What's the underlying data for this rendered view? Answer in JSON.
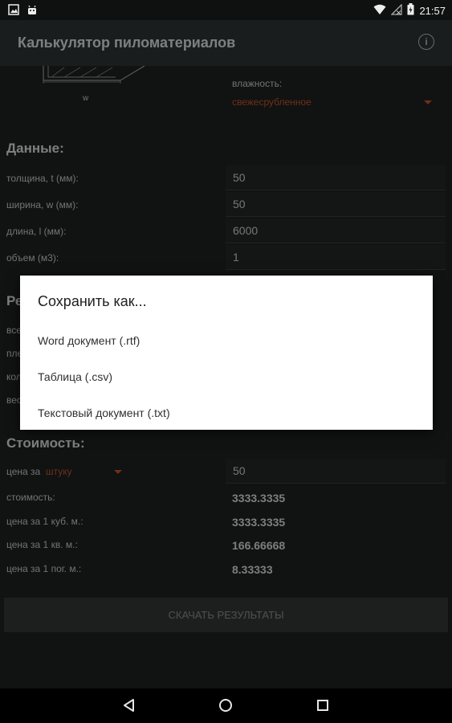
{
  "status_bar": {
    "time": "21:57"
  },
  "app": {
    "title": "Калькулятор пиломатериалов"
  },
  "diagram": {
    "w_label": "w"
  },
  "humidity": {
    "label": "влажность:",
    "value": "свежесрубленное"
  },
  "data_section": {
    "title": "Данные:",
    "rows": [
      {
        "label": "толщина, t (мм):",
        "value": "50"
      },
      {
        "label": "ширина, w (мм):",
        "value": "50"
      },
      {
        "label": "длина, l (мм):",
        "value": "6000"
      },
      {
        "label": "объем (м3):",
        "value": "1"
      }
    ]
  },
  "results_section": {
    "title_partial": "Ре",
    "row_fragments": [
      "все",
      "пле",
      "кол",
      "вес"
    ]
  },
  "cost_section": {
    "title": "Стоимость:",
    "price_label": "цена за",
    "price_unit": "штуку",
    "price_value": "50",
    "rows": [
      {
        "label": "стоимость:",
        "value": "3333.3335"
      },
      {
        "label": "цена за 1 куб. м.:",
        "value": "3333.3335"
      },
      {
        "label": "цена за 1 кв. м.:",
        "value": "166.66668"
      },
      {
        "label": "цена за 1 пог. м.:",
        "value": "8.33333"
      }
    ]
  },
  "download_button": {
    "label": "СКАЧАТЬ РЕЗУЛЬТАТЫ"
  },
  "dialog": {
    "title": "Сохранить как...",
    "options": [
      "Word документ (.rtf)",
      "Таблица (.csv)",
      "Текстовый документ (.txt)"
    ]
  },
  "icons": {
    "status_left": [
      "image-notification-icon",
      "android-notification-icon"
    ],
    "status_right": [
      "wifi-icon",
      "no-signal-icon",
      "battery-charging-icon"
    ],
    "appbar": "info-icon",
    "nav": [
      "back-icon",
      "home-icon",
      "recents-icon"
    ]
  },
  "colors": {
    "accent": "#c8582f",
    "background": "#1f2222",
    "appbar": "#313535",
    "dialog": "#ffffff"
  }
}
